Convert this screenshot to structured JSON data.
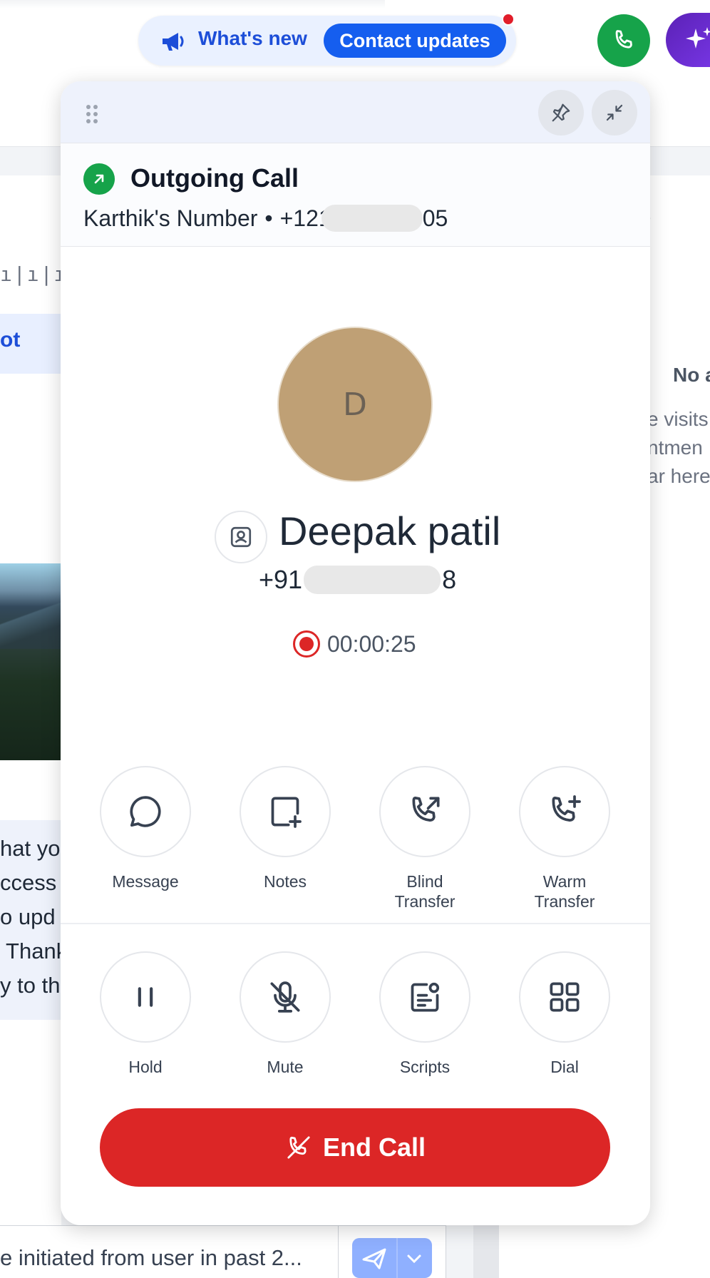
{
  "topbar": {
    "whats_new_label": "What's new",
    "contact_updates_label": "Contact updates"
  },
  "call_panel": {
    "direction_title": "Outgoing Call",
    "line_name": "Karthik's Number",
    "line_separator": "•",
    "line_number_prefix": "+121",
    "line_number_suffix": "05",
    "contact": {
      "initial": "D",
      "name": "Deepak patil",
      "number_prefix": "+91",
      "number_suffix": "8"
    },
    "call_timer": "00:00:25",
    "actions_row1": [
      {
        "label": "Message",
        "icon": "chat-bubble-icon"
      },
      {
        "label": "Notes",
        "icon": "add-note-icon"
      },
      {
        "label": "Blind\nTransfer",
        "icon": "phone-forward-icon"
      },
      {
        "label": "Warm\nTransfer",
        "icon": "phone-add-icon"
      }
    ],
    "actions_row2": [
      {
        "label": "Hold",
        "icon": "pause-icon"
      },
      {
        "label": "Mute",
        "icon": "mic-off-icon"
      },
      {
        "label": "Scripts",
        "icon": "script-icon"
      },
      {
        "label": "Dial",
        "icon": "dialpad-icon"
      }
    ],
    "end_call_label": "End Call"
  },
  "background": {
    "left_link_fragment": "ot",
    "left_message_lines": "hat you\nccess\no upd\n Thank\ny to th",
    "right_paren": ")",
    "right_no_a": "No a",
    "right_visits": "e visits\nntmen\nar here",
    "composer_text": "e initiated from user in past 2..."
  },
  "colors": {
    "accent_blue": "#155eef",
    "call_green": "#16a34a",
    "end_call_red": "#dc2626",
    "avatar_tan": "#bfa075"
  }
}
